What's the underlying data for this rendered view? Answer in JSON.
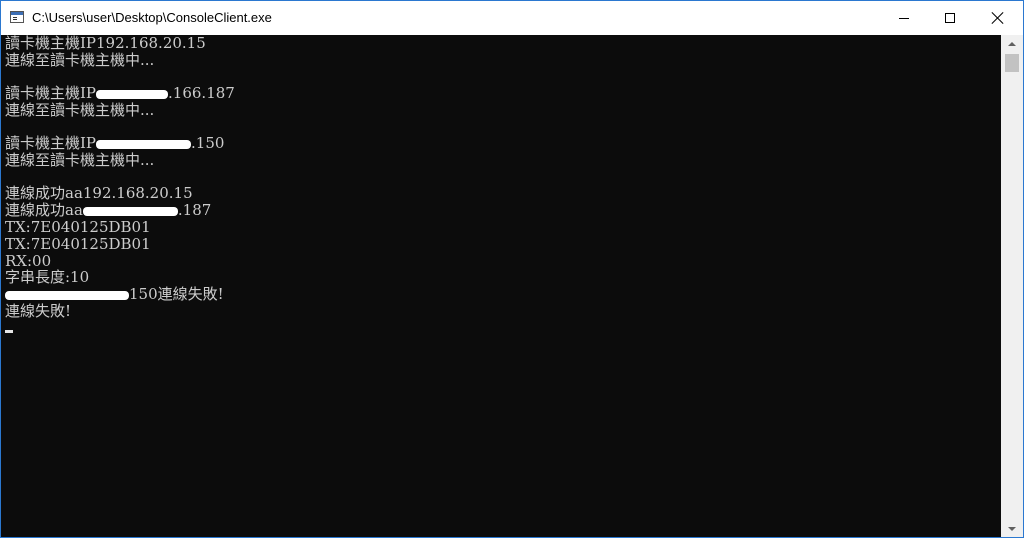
{
  "window": {
    "title": "C:\\Users\\user\\Desktop\\ConsoleClient.exe"
  },
  "console": {
    "lines": [
      {
        "text": "讀卡機主機IP192.168.20.15"
      },
      {
        "text": "連線至讀卡機主機中..."
      },
      {
        "text": ""
      },
      {
        "prefix": "讀卡機主機IP",
        "suffix": ".166.187"
      },
      {
        "text": "連線至讀卡機主機中..."
      },
      {
        "text": ""
      },
      {
        "prefix": "讀卡機主機IP",
        "suffix": ".150"
      },
      {
        "text": "連線至讀卡機主機中..."
      },
      {
        "text": ""
      },
      {
        "text": "連線成功aa192.168.20.15"
      },
      {
        "prefix": "連線成功aa",
        "suffix": ".187"
      },
      {
        "text": "TX:7E040125DB01"
      },
      {
        "text": "TX:7E040125DB01"
      },
      {
        "text": "RX:00"
      },
      {
        "text": "字串長度:10"
      },
      {
        "prefix": "",
        "suffix": "150連線失敗!"
      },
      {
        "text": "連線失敗!"
      }
    ]
  },
  "colors": {
    "console_background": "#0c0c0c",
    "console_text": "#cccccc",
    "window_border": "#2b78d0"
  },
  "icons": {
    "app": "console-app-icon",
    "minimize": "minimize-icon",
    "maximize": "maximize-icon",
    "close": "close-icon"
  }
}
